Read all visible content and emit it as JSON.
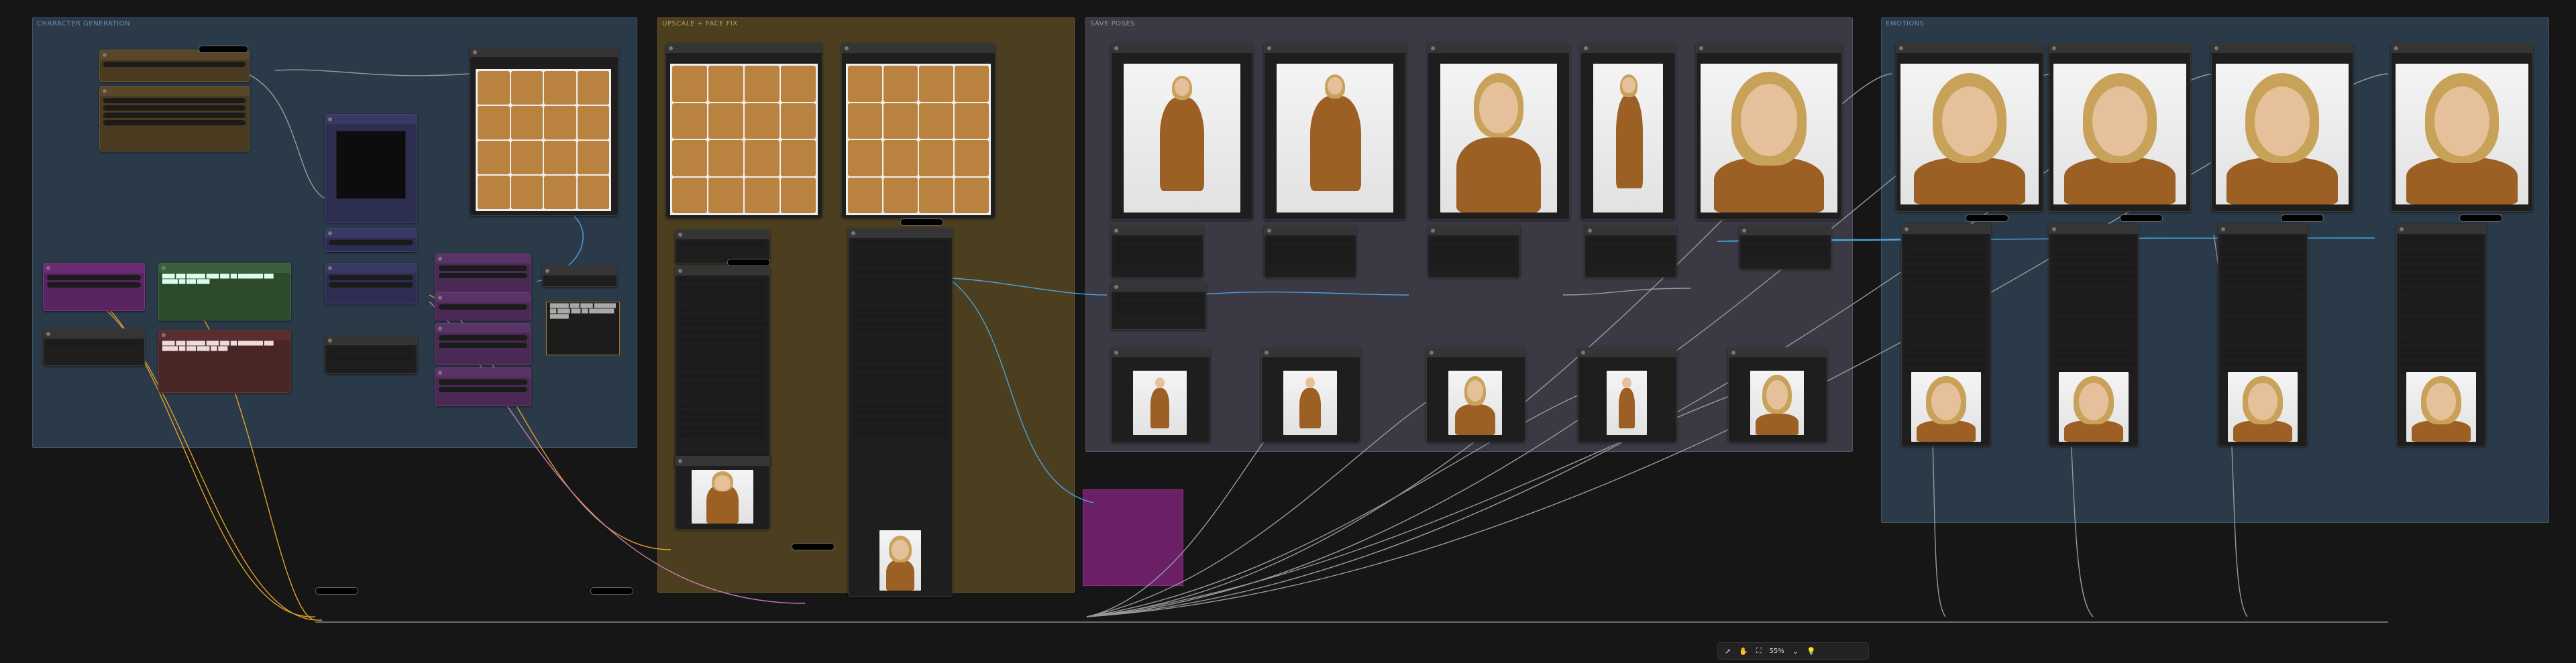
{
  "groups": {
    "g1": "CHARACTER GENERATION",
    "g2": "UPSCALE + FACE FIX",
    "g3": "SAVE POSES",
    "g4": "EMOTIONS"
  },
  "zoom": "55%",
  "colors": {
    "canvas": "#161616",
    "group_blue": "#2b3a48",
    "group_olive": "#4b3f1f",
    "group_slate": "#3a3944",
    "group_purple": "#6a1f66",
    "wire_blue": "#4aa3e0",
    "wire_orange": "#e0a030",
    "wire_grey": "#9a9a9a",
    "wire_pink": "#d07ab0"
  },
  "icons": [
    "select-cursor-icon",
    "hand-pan-icon",
    "fit-view-icon",
    "chevron-down-icon",
    "lightbulb-icon"
  ]
}
